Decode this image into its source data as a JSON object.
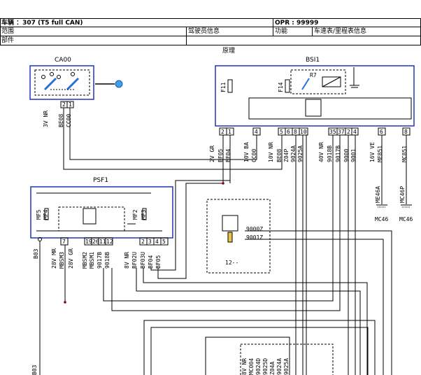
{
  "header": {
    "vehicle": "车辆 ：307 (T5 full CAN)",
    "opr": "OPR : 99999",
    "range_label": "范围",
    "range_value": "驾驶员信息",
    "function_label": "功能",
    "function_value": "车速表/里程表信息",
    "part_label": "部件",
    "principle": "原理"
  },
  "components": {
    "ca00": "CA00",
    "bsi1": "BSI1",
    "psf1": "PSF1",
    "r7": "R7",
    "f11": "F11",
    "f14": "F14",
    "mf5": "MF5",
    "mf4": "MF4",
    "mf2": "MF2",
    "mf3": "MF3",
    "b03": "B03",
    "mc46_a": "MC46",
    "mc46_b": "MC46",
    "me46a": "ME46A",
    "mc46p": "MC46P",
    "c12": "12--",
    "w9000z": "9000Z",
    "w9001z": "9001Z",
    "b03_bottom": "B03"
  },
  "ca00_connector": {
    "pins": [
      "2",
      "1"
    ],
    "connector_label": "3V NR",
    "wires": [
      "BE08",
      "CC00"
    ]
  },
  "bsi_pins": [
    "2",
    "1",
    "4",
    "5",
    "6",
    "8",
    "10",
    "35",
    "37",
    "2",
    "4",
    "6",
    "8"
  ],
  "bsi_labels": {
    "g1_connector": "2V GR",
    "g1_wires": [
      "BF05",
      "BF04"
    ],
    "g2_connector": "10V BA",
    "g2_wires": [
      "CC00"
    ],
    "g3_connector": "10V NR",
    "g3_wires": [
      "BE08",
      "Z04P",
      "9024A",
      "9025A"
    ],
    "g4_connector": "40V NR",
    "g4_wires": [
      "9018B",
      "9017B",
      "9000",
      "9001"
    ],
    "g5_connector": "16V VE",
    "g5_wires": [
      "ME851"
    ],
    "g6_wires": [
      "MC851"
    ]
  },
  "psf_pins": [
    "7",
    "19",
    "26",
    "11",
    "12",
    "2",
    "3",
    "4",
    "5"
  ],
  "psf_labels": {
    "g1_connector": "28V MR",
    "g1_wires": [
      "MBSM3"
    ],
    "g2_connector": "28V GR",
    "g2_wires": [
      "MBSM2",
      "MBSM1",
      "9017B",
      "9018B"
    ],
    "g3_connector": "8V NR",
    "g3_wires": [
      "BF02U",
      "BF03U",
      "BF04",
      "BF05"
    ]
  },
  "bottom_labels": {
    "connector": "8V NR",
    "wires": [
      "MC004",
      "9024D",
      "9025D",
      "Z04A",
      "9024A",
      "9025A"
    ]
  }
}
